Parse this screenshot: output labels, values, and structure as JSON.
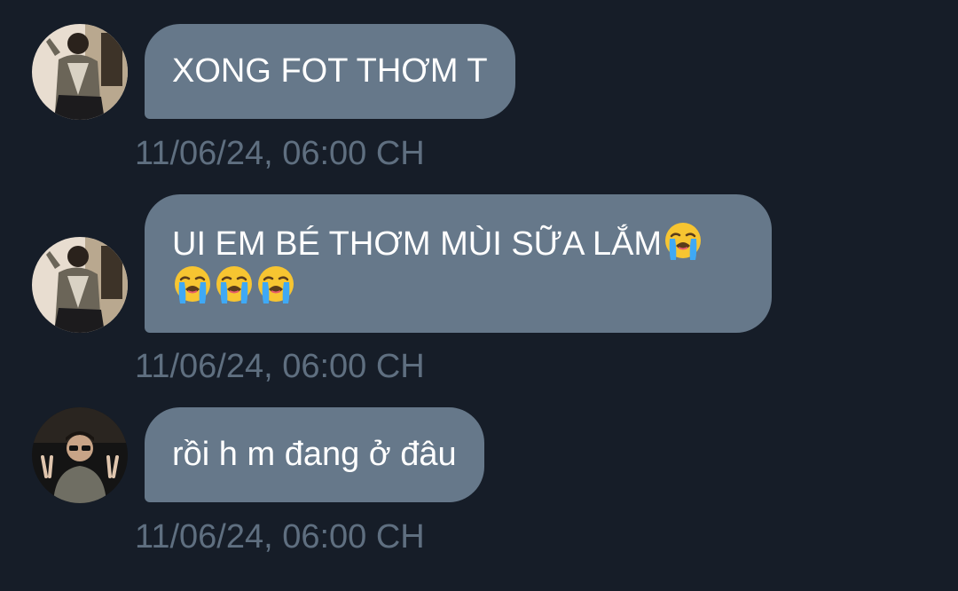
{
  "messages": [
    {
      "text_lines": [
        "XONG FOT THƠM T"
      ],
      "emoji_count_line1": 0,
      "emoji_count_line2": 0,
      "timestamp": "11/06/24, 06:00 CH",
      "avatar": "avatar-user-a"
    },
    {
      "text_lines": [
        "UI EM BÉ THƠM MÙI SỮA LẮM",
        ""
      ],
      "emoji_count_line1": 1,
      "emoji_count_line2": 3,
      "emoji_name": "loudly-crying-face-emoji",
      "timestamp": "11/06/24, 06:00 CH",
      "avatar": "avatar-user-a"
    },
    {
      "text_lines": [
        "rồi h m đang ở đâu"
      ],
      "emoji_count_line1": 0,
      "emoji_count_line2": 0,
      "timestamp": "11/06/24, 06:00 CH",
      "avatar": "avatar-user-b"
    }
  ],
  "colors": {
    "background": "#161d28",
    "bubble": "#66788a",
    "timestamp": "#5f6f80",
    "text": "#ffffff"
  }
}
